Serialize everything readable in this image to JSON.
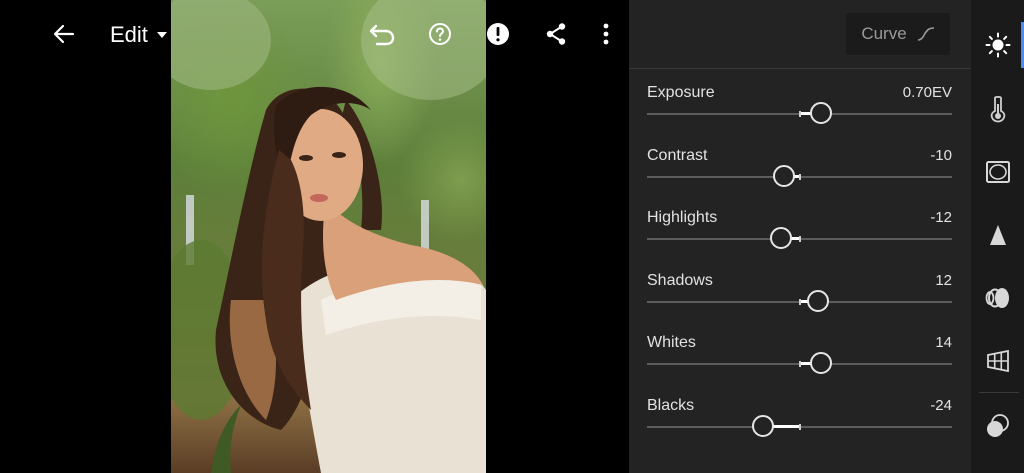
{
  "toolbar": {
    "mode_label": "Edit",
    "icons": [
      "back-arrow-icon",
      "chevron-down-icon",
      "undo-icon",
      "help-icon",
      "alert-icon",
      "share-icon",
      "more-vertical-icon"
    ]
  },
  "panel": {
    "curve_label": "Curve",
    "adjustments": [
      {
        "label": "Exposure",
        "value": "0.70EV",
        "level": 0.14
      },
      {
        "label": "Contrast",
        "value": "-10",
        "level": -0.1
      },
      {
        "label": "Highlights",
        "value": "-12",
        "level": -0.12
      },
      {
        "label": "Shadows",
        "value": "12",
        "level": 0.12
      },
      {
        "label": "Whites",
        "value": "14",
        "level": 0.14
      },
      {
        "label": "Blacks",
        "value": "-24",
        "level": -0.24
      }
    ]
  },
  "rail": {
    "active": "light",
    "tools": [
      "light-icon",
      "color-temperature-icon",
      "effects-icon",
      "detail-icon",
      "optics-icon",
      "geometry-icon",
      "masking-icon"
    ]
  },
  "colors": {
    "panel_bg": "#232323",
    "rail_bg": "#1a1a1a",
    "accent": "#4a8cf0"
  }
}
